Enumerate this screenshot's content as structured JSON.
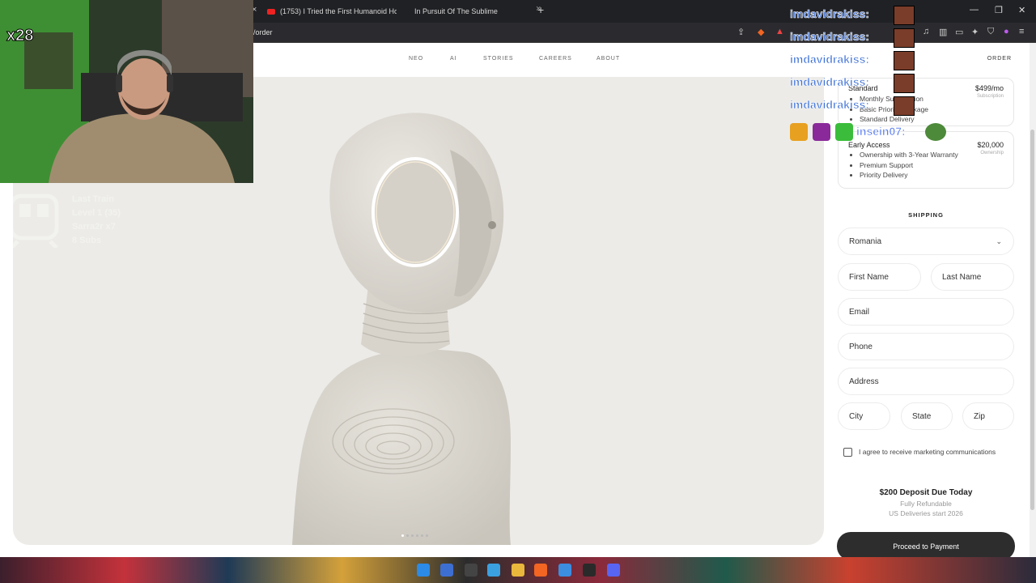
{
  "browser": {
    "tabs": [
      {
        "label": "(1753) I Tried the First Humanoid Ho"
      },
      {
        "label": "In Pursuit Of The Sublime"
      }
    ],
    "url": "/order",
    "new_tab": "+",
    "close": "×"
  },
  "nav": {
    "items": [
      "NEO",
      "AI",
      "STORIES",
      "CAREERS",
      "ABOUT"
    ],
    "order": "ORDER"
  },
  "plans": [
    {
      "title": "Standard",
      "price": "$499/mo",
      "sub": "Subscription",
      "features": [
        "Monthly Subscription",
        "Basic Priority Package",
        "Standard Delivery"
      ]
    },
    {
      "title": "Early Access",
      "price": "$20,000",
      "sub": "Ownership",
      "features": [
        "Ownership with 3-Year Warranty",
        "Premium Support",
        "Priority Delivery"
      ]
    }
  ],
  "shipping": {
    "heading": "SHIPPING",
    "country": "Romania",
    "first_name": "First Name",
    "last_name": "Last Name",
    "email": "Email",
    "phone": "Phone",
    "address": "Address",
    "city": "City",
    "state": "State",
    "zip": "Zip",
    "marketing_label": "I agree to receive marketing communications"
  },
  "deposit": {
    "title": "$200 Deposit Due Today",
    "refund": "Fully Refundable",
    "delivery": "US Deliveries start 2026"
  },
  "cta": "Proceed to Payment",
  "overlay": {
    "counter": "x28",
    "sub_goal": [
      "Last Train",
      "Level 1 (35)",
      "Sarra2r x7",
      "8 Subs"
    ],
    "chat": [
      "imdavidrakiss:",
      "imdavidrakiss:",
      "imdavidrakiss:",
      "imdavidrakiss:",
      "imdavidrakiss:",
      "insein07:"
    ]
  },
  "colors": {
    "hero_bg": "#ecebe7",
    "cta_bg": "#2d2d2d",
    "chat_name": "#3b6fd6",
    "webcam_green": "#5cf03b"
  }
}
